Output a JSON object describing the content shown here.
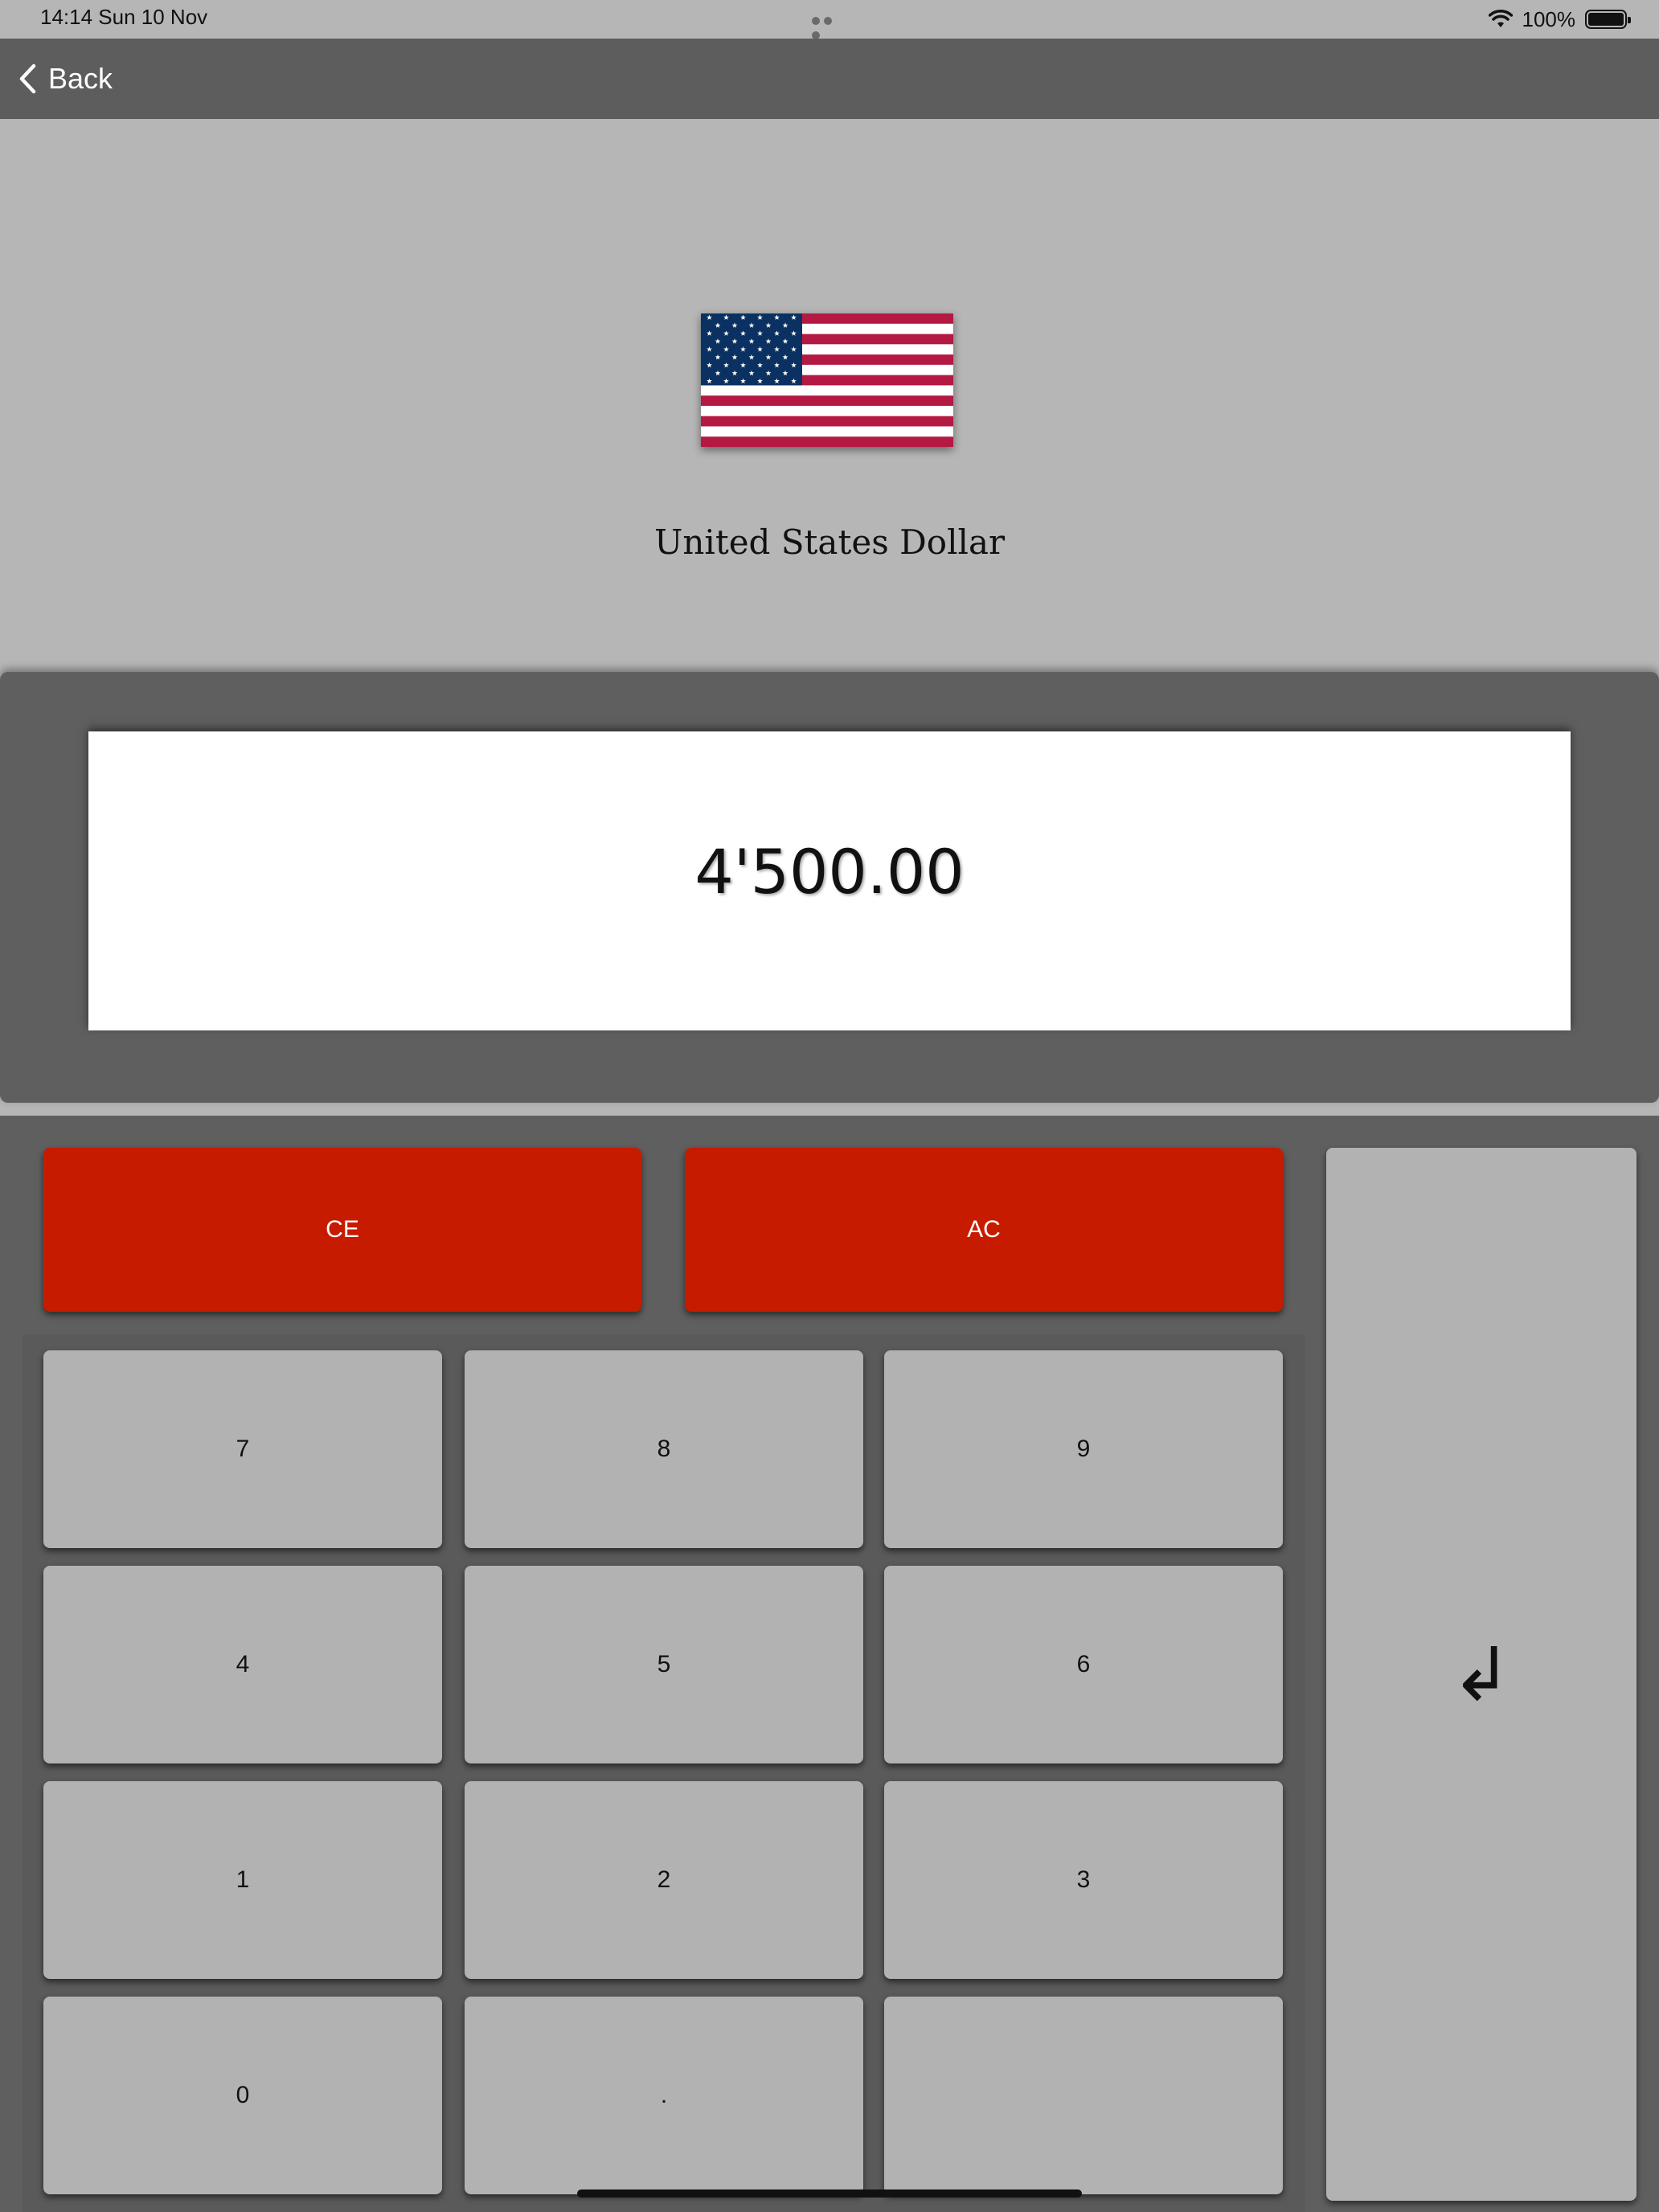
{
  "status_bar": {
    "time": "14:14   Sun 10 Nov",
    "battery_percent": "100%"
  },
  "nav": {
    "back_label": "Back"
  },
  "currency": {
    "name": "United States Dollar",
    "flag": "us-flag"
  },
  "display": {
    "value": "4'500.00"
  },
  "keypad": {
    "ce_label": "CE",
    "ac_label": "AC",
    "keys": {
      "seven": "7",
      "eight": "8",
      "nine": "9",
      "four": "4",
      "five": "5",
      "six": "6",
      "one": "1",
      "two": "2",
      "three": "3",
      "zero": "0",
      "decimal": ".",
      "blank": ""
    },
    "enter_icon": "↲"
  },
  "colors": {
    "background": "#b6b6b6",
    "nav_bar": "#5d5d5d",
    "panel": "#5f5f5f",
    "key": "#b2b2b2",
    "clear_key": "#c71b00"
  }
}
